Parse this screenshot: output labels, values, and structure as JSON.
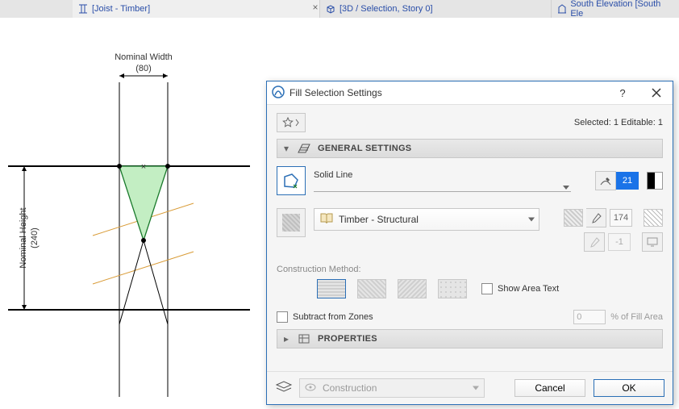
{
  "tabs": [
    {
      "label": "[Joist - Timber]"
    },
    {
      "label": "[3D / Selection, Story 0]"
    },
    {
      "label": "South Elevation [South Ele"
    }
  ],
  "drawing": {
    "width_label": "Nominal Width",
    "width_value": "(80)",
    "height_label": "Nominal Height",
    "height_value": "(240)"
  },
  "dialog": {
    "title": "Fill Selection Settings",
    "status": "Selected: 1 Editable: 1",
    "sections": {
      "general": "GENERAL SETTINGS",
      "properties": "PROPERTIES"
    },
    "line_type": "Solid Line",
    "material": "Timber - Structural",
    "pen_fg": "21",
    "pen_bg_num": "174",
    "pen_x": "-1",
    "construction_method": "Construction Method:",
    "show_area_text": "Show Area Text",
    "subtract_from_zones": "Subtract from Zones",
    "fill_area_pct": "0",
    "fill_area_label": "% of Fill Area",
    "layer": "Construction",
    "cancel": "Cancel",
    "ok": "OK"
  }
}
